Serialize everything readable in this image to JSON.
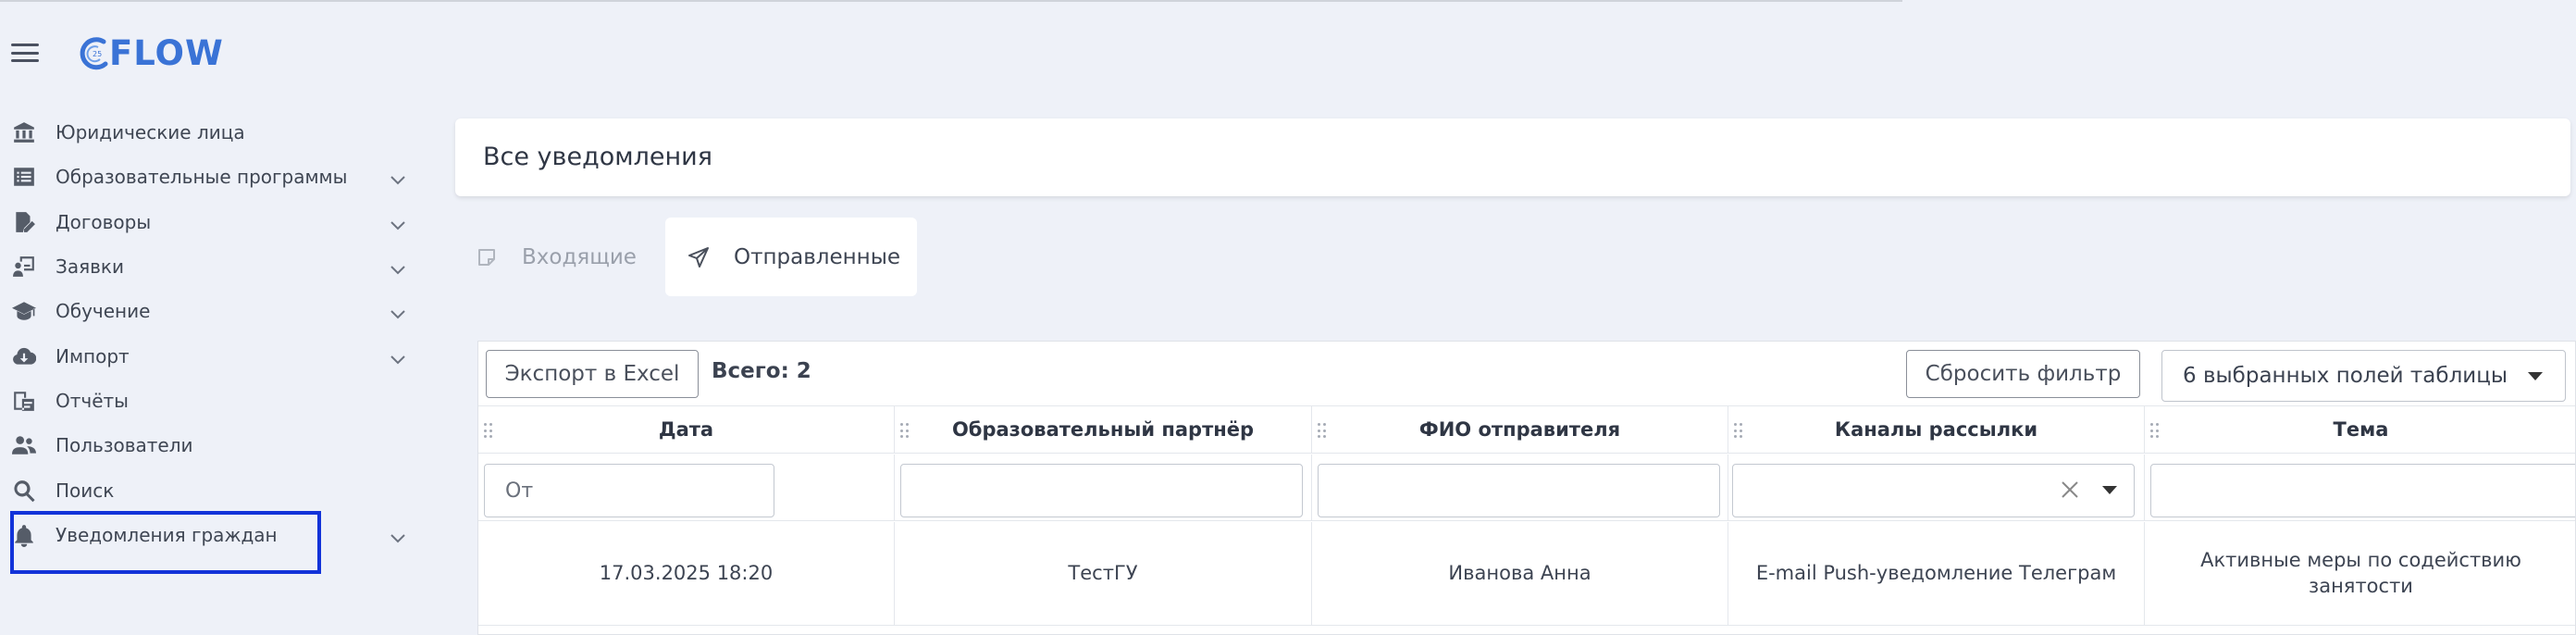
{
  "app": {
    "logo_text": "FLOW",
    "logo_badge": "25",
    "accent_color": "#3a73d6"
  },
  "sidebar": {
    "items": [
      {
        "label": "Юридические лица",
        "icon": "bank-icon",
        "has_chevron": false
      },
      {
        "label": "Образовательные программы",
        "icon": "list-icon",
        "has_chevron": true
      },
      {
        "label": "Договоры",
        "icon": "document-edit-icon",
        "has_chevron": true
      },
      {
        "label": "Заявки",
        "icon": "teacher-icon",
        "has_chevron": true
      },
      {
        "label": "Обучение",
        "icon": "graduation-cap-icon",
        "has_chevron": true
      },
      {
        "label": "Импорт",
        "icon": "cloud-download-icon",
        "has_chevron": true
      },
      {
        "label": "Отчёты",
        "icon": "reports-icon",
        "has_chevron": false
      },
      {
        "label": "Пользователи",
        "icon": "users-icon",
        "has_chevron": false
      },
      {
        "label": "Поиск",
        "icon": "search-icon",
        "has_chevron": false
      },
      {
        "label": "Уведомления граждан",
        "icon": "bell-icon",
        "has_chevron": true
      }
    ]
  },
  "main": {
    "title": "Все уведомления",
    "tabs": [
      {
        "label": "Входящие",
        "icon": "inbox-note-icon",
        "active": false
      },
      {
        "label": "Отправленные",
        "icon": "send-icon",
        "active": true
      }
    ],
    "toolbar": {
      "export_label": "Экспорт в Excel",
      "total_label": "Всего: 2",
      "reset_filter_label": "Сбросить фильтр",
      "fields_select_value": "6 выбранных полей таблицы"
    },
    "table": {
      "columns": [
        "Дата",
        "Образовательный партнёр",
        "ФИО отправителя",
        "Каналы рассылки",
        "Тема"
      ],
      "filters": {
        "date_placeholder": "От"
      },
      "rows": [
        {
          "date": "17.03.2025 18:20",
          "partner": "ТестГУ",
          "sender": "Иванова Анна",
          "channels": "E-mail Push-уведомление Телеграм",
          "topic": "Активные меры по содействию занятости"
        }
      ]
    }
  }
}
